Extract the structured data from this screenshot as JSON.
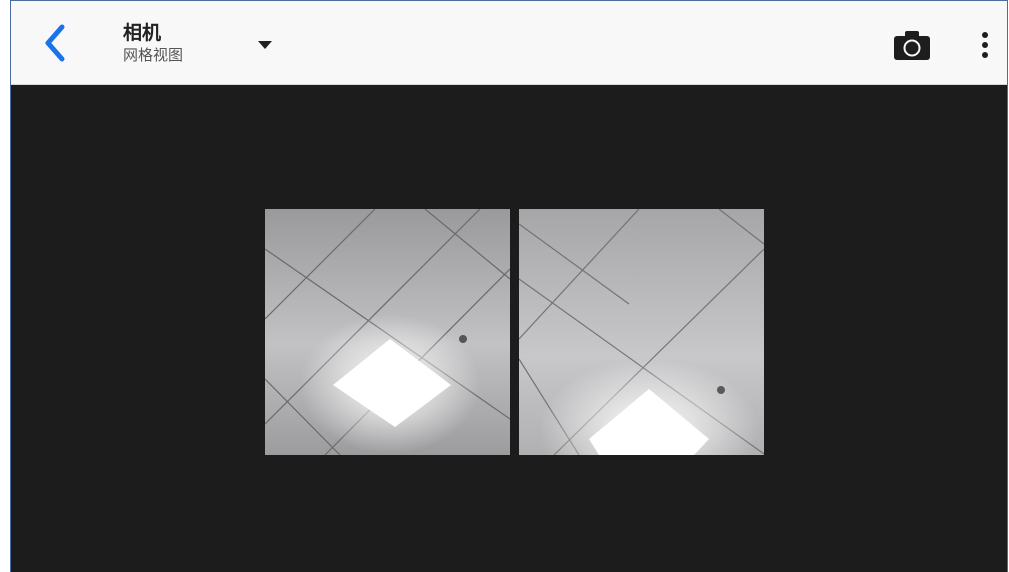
{
  "app_bar": {
    "title": "相机",
    "subtitle": "网格视图",
    "accent_color": "#1a73e8"
  },
  "icons": {
    "back": "back-chevron-icon",
    "dropdown": "dropdown-caret-icon",
    "camera": "camera-icon",
    "more": "more-vert-icon"
  },
  "grid": {
    "items": [
      {
        "label": "ceiling-photo-1"
      },
      {
        "label": "ceiling-photo-2"
      }
    ]
  }
}
